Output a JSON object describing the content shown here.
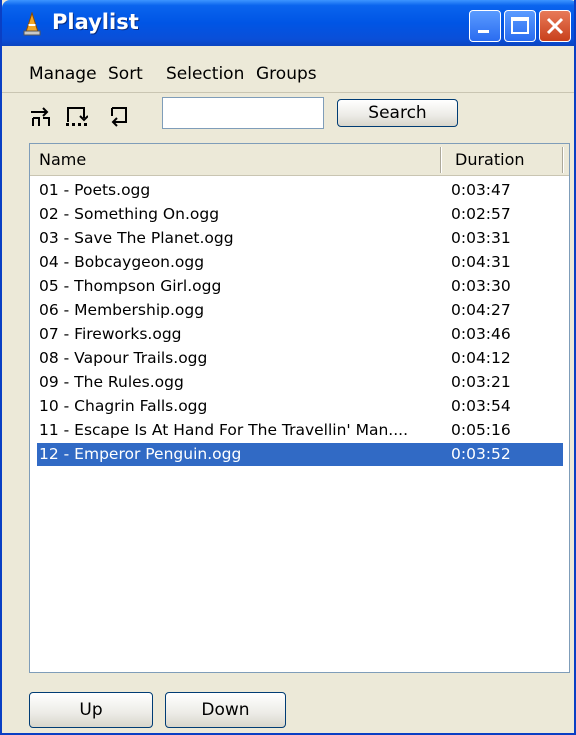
{
  "window": {
    "title": "Playlist"
  },
  "menu": [
    "Manage",
    "Sort",
    "Selection",
    "Groups"
  ],
  "toolbar": {
    "icons": [
      "shuffle-icon",
      "repeat-icon",
      "loop-icon"
    ],
    "search_value": "",
    "search_button": "Search"
  },
  "list": {
    "columns": [
      "Name",
      "Duration"
    ],
    "rows": [
      {
        "name": "01 - Poets.ogg",
        "duration": "0:03:47"
      },
      {
        "name": "02 - Something On.ogg",
        "duration": "0:02:57"
      },
      {
        "name": "03 - Save The Planet.ogg",
        "duration": "0:03:31"
      },
      {
        "name": "04 - Bobcaygeon.ogg",
        "duration": "0:04:31"
      },
      {
        "name": "05 - Thompson Girl.ogg",
        "duration": "0:03:30"
      },
      {
        "name": "06 - Membership.ogg",
        "duration": "0:04:27"
      },
      {
        "name": "07 - Fireworks.ogg",
        "duration": "0:03:46"
      },
      {
        "name": "08 - Vapour Trails.ogg",
        "duration": "0:04:12"
      },
      {
        "name": "09 - The Rules.ogg",
        "duration": "0:03:21"
      },
      {
        "name": "10 - Chagrin Falls.ogg",
        "duration": "0:03:54"
      },
      {
        "name": "11 - Escape Is At Hand For The Travellin' Man....",
        "duration": "0:05:16"
      },
      {
        "name": "12 - Emperor Penguin.ogg",
        "duration": "0:03:52",
        "selected": true
      }
    ]
  },
  "buttons": {
    "up": "Up",
    "down": "Down"
  },
  "colors": {
    "title_bar": "#0055e5",
    "selection": "#316ac5",
    "window_bg": "#ece9d8"
  }
}
